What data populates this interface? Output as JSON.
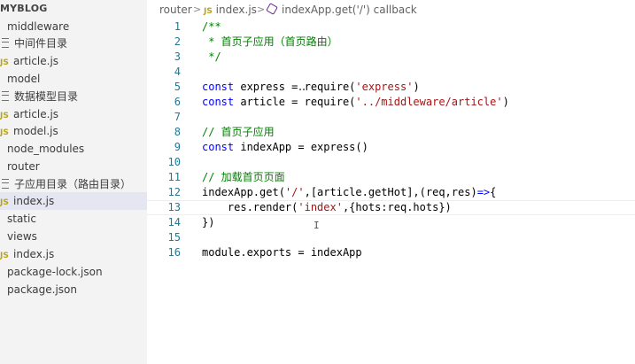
{
  "sidebar": {
    "root_label": "MYBLOG",
    "items": [
      {
        "label": "middleware",
        "type": "folder"
      },
      {
        "label": "中间件目录",
        "type": "doc"
      },
      {
        "label": "article.js",
        "type": "js"
      },
      {
        "label": "model",
        "type": "folder"
      },
      {
        "label": "数据模型目录",
        "type": "doc"
      },
      {
        "label": "article.js",
        "type": "js"
      },
      {
        "label": "model.js",
        "type": "js"
      },
      {
        "label": "node_modules",
        "type": "folder"
      },
      {
        "label": "router",
        "type": "folder"
      },
      {
        "label": "子应用目录（路由目录）",
        "type": "doc"
      },
      {
        "label": "index.js",
        "type": "js",
        "selected": true
      },
      {
        "label": "static",
        "type": "folder"
      },
      {
        "label": "views",
        "type": "folder"
      },
      {
        "label": "index.js",
        "type": "js"
      },
      {
        "label": "package-lock.json",
        "type": "file"
      },
      {
        "label": "package.json",
        "type": "file"
      }
    ],
    "js_badge": "JS"
  },
  "breadcrumb": {
    "folder": "router",
    "file": "index.js",
    "symbol": "indexApp.get('/') callback",
    "separator": ">",
    "js_badge": "JS"
  },
  "editor": {
    "line_numbers": [
      "1",
      "2",
      "3",
      "4",
      "5",
      "6",
      "7",
      "8",
      "9",
      "10",
      "11",
      "12",
      "13",
      "14",
      "15",
      "16"
    ],
    "lines": [
      "/**",
      " * 首页子应用（首页路由）",
      " */",
      "",
      "const express = require('express')",
      "const article = require('../middleware/article')",
      "",
      "// 首页子应用",
      "const indexApp = express()",
      "",
      "// 加载首页页面",
      "indexApp.get('/',[article.getHot],(req,res)=>{",
      "    res.render('index',{hots:req.hots})",
      "})",
      "",
      "module.exports = indexApp"
    ],
    "current_line": 13
  },
  "colors": {
    "keyword": "#0000ff",
    "string": "#a31515",
    "comment": "#008000",
    "line_number": "#237893",
    "js_icon": "#b8a31b",
    "selection": "#e4e6f1"
  }
}
